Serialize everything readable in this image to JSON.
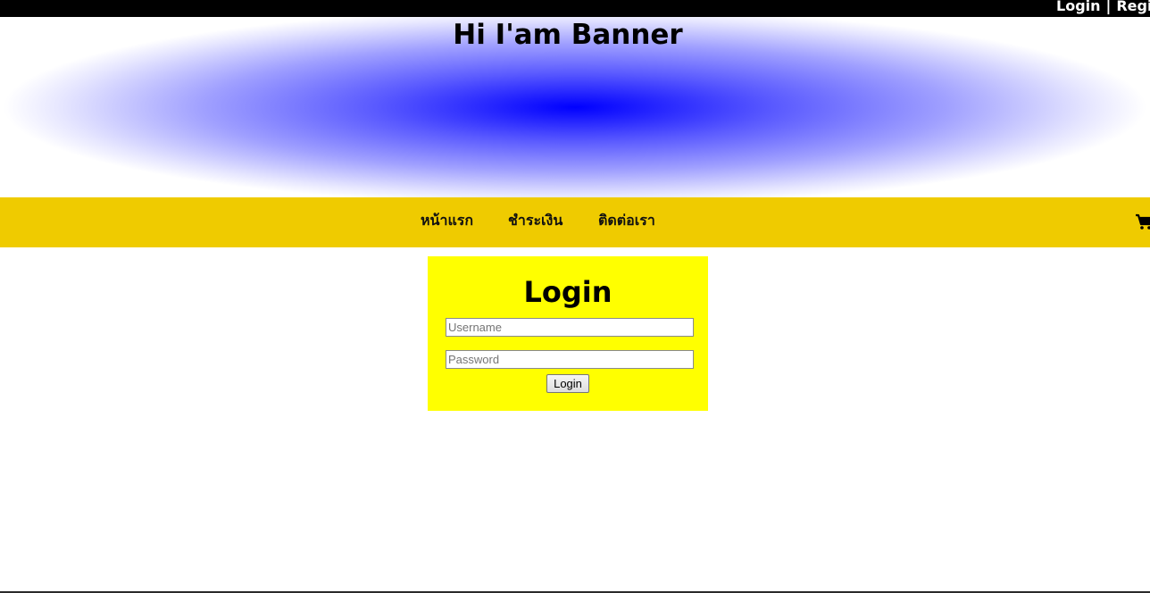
{
  "topbar": {
    "login_link": "Login",
    "separator": "|",
    "register_link": "Register"
  },
  "banner": {
    "title": "Hi I'am Banner",
    "gradient_center_color": "#0000ff"
  },
  "nav": {
    "background_color": "#efcb00",
    "items": [
      {
        "label": "หน้าแรก"
      },
      {
        "label": "ชำระเงิน"
      },
      {
        "label": "ติดต่อเรา"
      }
    ],
    "cart_icon": "shopping-cart-icon"
  },
  "login_form": {
    "title": "Login",
    "background_color": "#ffff00",
    "username_placeholder": "Username",
    "password_placeholder": "Password",
    "submit_label": "Login"
  }
}
